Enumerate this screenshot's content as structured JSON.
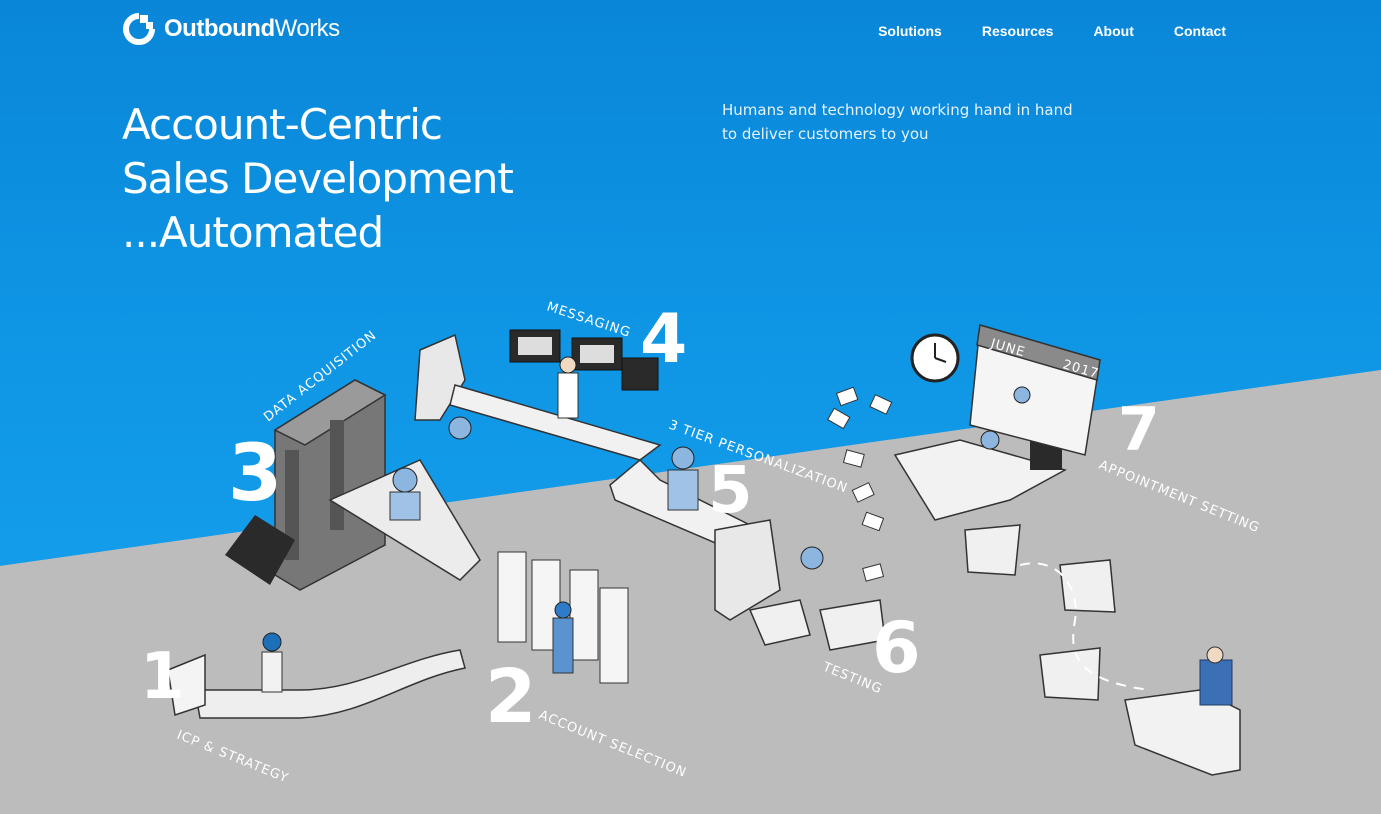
{
  "brand": {
    "name_bold": "Outbound",
    "name_light": "Works",
    "accent": "#0f8fe0"
  },
  "nav": {
    "items": [
      "Solutions",
      "Resources",
      "About",
      "Contact"
    ]
  },
  "hero": {
    "title_lines": [
      "Account-Centric",
      "Sales Development",
      "...Automated"
    ],
    "tagline": "Humans and technology working hand in hand to deliver customers to you"
  },
  "illustration": {
    "steps": [
      {
        "number": "1",
        "label": "ICP & STRATEGY"
      },
      {
        "number": "2",
        "label": "ACCOUNT SELECTION"
      },
      {
        "number": "3",
        "label": "DATA ACQUISITION"
      },
      {
        "number": "4",
        "label": "MESSAGING"
      },
      {
        "number": "5",
        "label": "3 TIER PERSONALIZATION"
      },
      {
        "number": "6",
        "label": "TESTING"
      },
      {
        "number": "7",
        "label": "APPOINTMENT SETTING"
      }
    ],
    "calendar": {
      "month": "JUNE",
      "year": "2017"
    }
  }
}
